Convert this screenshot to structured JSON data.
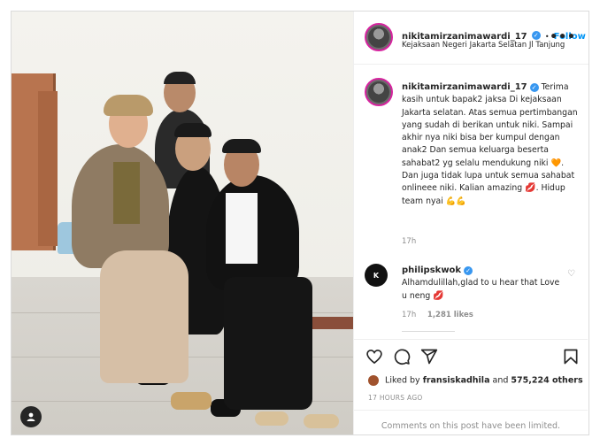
{
  "post": {
    "username": "nikitamirzanimawardi_17",
    "verified_mark": "✓",
    "follow_label": "Follow",
    "dot": "•",
    "location": "Kejaksaan Negeri Jakarta Selatan Jl Tanjung",
    "more_icon": "•••"
  },
  "caption": {
    "username": "nikitamirzanimawardi_17",
    "text_a": "Terima kasih untuk bapak2 jaksa Di kejaksaan Jakarta selatan. Atas semua pertimbangan yang sudah di berikan untuk niki. Sampai akhir nya niki bisa ber kumpul dengan anak2 Dan semua keluarga beserta sahabat2 yg selalu mendukung niki",
    "emoji_heart": "🧡",
    "text_b": ". Dan juga tidak lupa untuk semua sahabat onlineee niki. Kalian amazing",
    "emoji_lips": "💋",
    "text_c": ". Hidup team nyai",
    "emoji_arms": "💪💪",
    "time": "17h"
  },
  "comment": {
    "username": "philipskwok",
    "text": "Alhamdulillah,glad to u hear that Love u neng",
    "emoji_lips": "💋",
    "time": "17h",
    "likes": "1,281 likes"
  },
  "likes": {
    "prefix": "Liked by ",
    "user": "fransiskadhila",
    "middle": " and ",
    "count": "575,224 others"
  },
  "timestamp": "17 HOURS AGO",
  "comments_limited": "Comments on this post have been limited.",
  "colors": {
    "accent": "#0095f6",
    "verified": "#3897f0",
    "muted": "#8e8e8e",
    "border": "#dbdbdb"
  },
  "icons": [
    "heart-icon",
    "comment-icon",
    "share-icon",
    "bookmark-icon",
    "user-tag-icon",
    "more-icon"
  ]
}
